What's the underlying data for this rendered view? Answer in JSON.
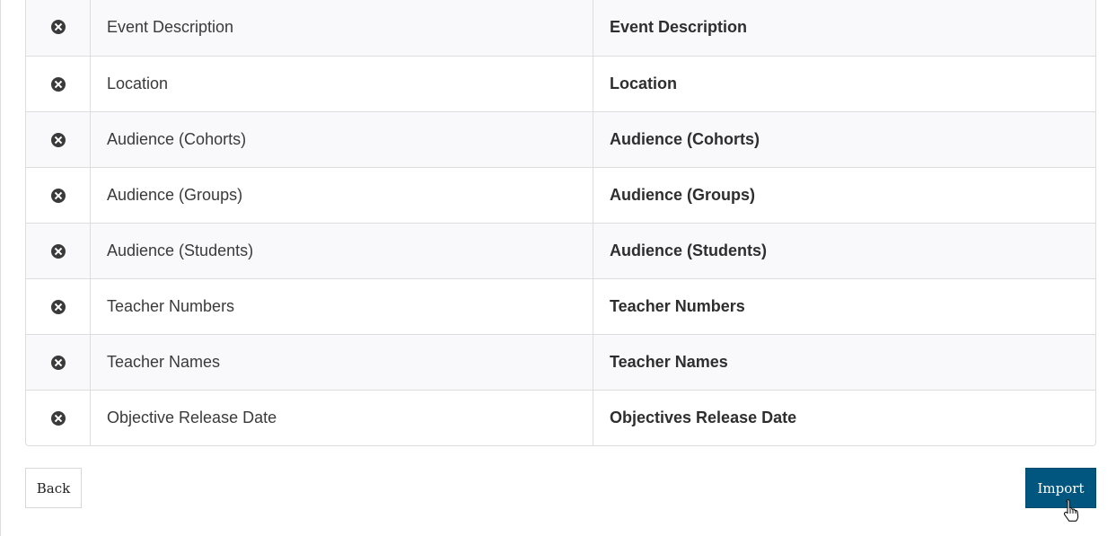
{
  "rows": [
    {
      "source": "Event Description",
      "target": "Event Description"
    },
    {
      "source": "Location",
      "target": "Location"
    },
    {
      "source": "Audience (Cohorts)",
      "target": "Audience (Cohorts)"
    },
    {
      "source": "Audience (Groups)",
      "target": "Audience (Groups)"
    },
    {
      "source": "Audience (Students)",
      "target": "Audience (Students)"
    },
    {
      "source": "Teacher Numbers",
      "target": "Teacher Numbers"
    },
    {
      "source": "Teacher Names",
      "target": "Teacher Names"
    },
    {
      "source": "Objective Release Date",
      "target": "Objectives Release Date"
    }
  ],
  "icons": {
    "remove": "remove-circle-icon",
    "cursor": "hand-pointer-cursor"
  },
  "buttons": {
    "back_label": "Back",
    "import_label": "Import"
  },
  "colors": {
    "import_bg": "#00567f",
    "stripe_bg": "#f9f9fb"
  }
}
